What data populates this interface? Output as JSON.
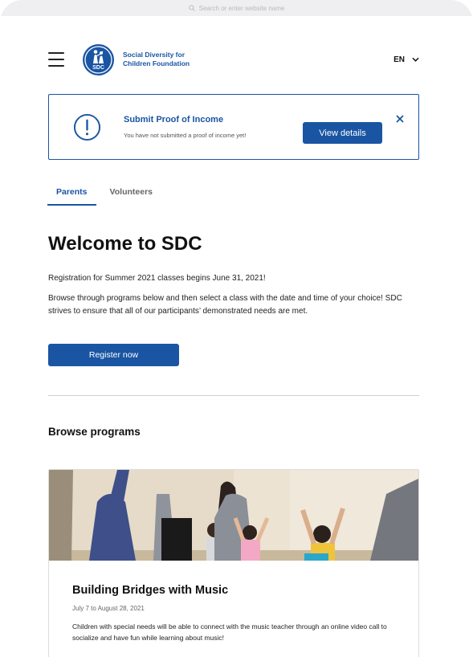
{
  "browser": {
    "address_placeholder": "Search or enter website name"
  },
  "header": {
    "org_name_line1": "Social Diversity for",
    "org_name_line2": "Children Foundation",
    "logo_text": "SDC",
    "language": "EN"
  },
  "alert": {
    "title": "Submit Proof of Income",
    "message": "You have not submitted a proof of income yet!",
    "button_label": "View details"
  },
  "tabs": [
    {
      "label": "Parents",
      "active": true
    },
    {
      "label": "Volunteers",
      "active": false
    }
  ],
  "welcome": {
    "title": "Welcome to SDC",
    "registration_text": "Registration for Summer 2021 classes begins June 31, 2021!",
    "description": "Browse through programs below and then select a class with the date and time of your choice! SDC strives to ensure that all of our participants’ demonstrated needs are met.",
    "register_button": "Register now"
  },
  "browse": {
    "title": "Browse programs",
    "programs": [
      {
        "title": "Building Bridges with Music",
        "dates": "July 7 to August 28, 2021",
        "description": "Children with special needs will be able to connect with the music teacher through an online video call to socialize and have fun while learning about music!"
      }
    ]
  },
  "colors": {
    "brand": "#1a55a3",
    "divider": "#cfcfd4",
    "text": "#111111"
  }
}
